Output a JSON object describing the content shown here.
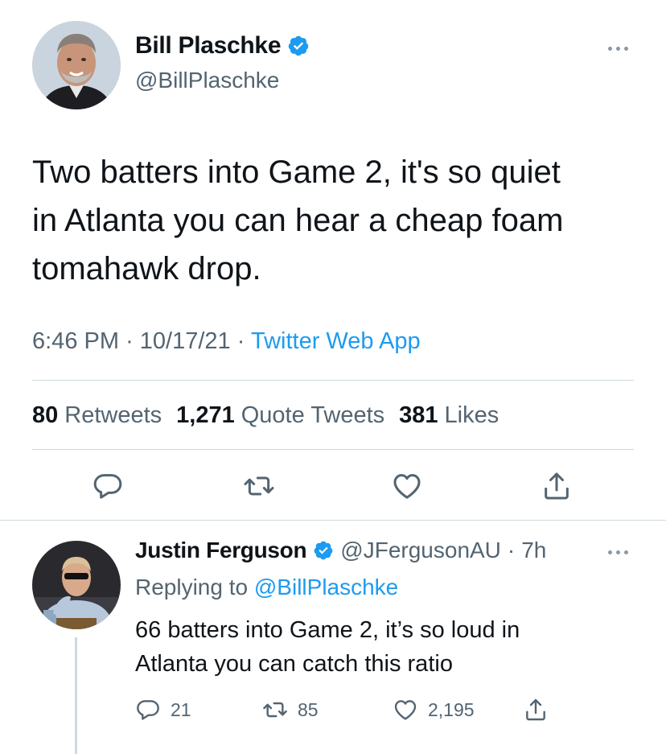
{
  "main_tweet": {
    "author_name": "Bill Plaschke",
    "author_handle": "@BillPlaschke",
    "text": "Two batters into Game 2, it's so quiet\nin Atlanta you can hear a cheap foam\ntomahawk drop.",
    "time": "6:46 PM",
    "date": "10/17/21",
    "separator": "·",
    "source": "Twitter Web App",
    "retweets_count": "80",
    "retweets_label": "Retweets",
    "quote_count": "1,271",
    "quote_label": "Quote Tweets",
    "likes_count": "381",
    "likes_label": "Likes"
  },
  "reply_tweet": {
    "author_name": "Justin Ferguson",
    "author_handle": "@JFergusonAU",
    "separator": "·",
    "time_ago": "7h",
    "replying_prefix": "Replying to",
    "replying_to": "@BillPlaschke",
    "text": "66 batters into Game 2, it’s so loud in\nAtlanta you can catch this ratio",
    "reply_count": "21",
    "retweet_count": "85",
    "like_count": "2,195"
  },
  "icons": {
    "verified": "verified-badge-icon",
    "more": "more-dots-icon",
    "reply": "reply-icon",
    "retweet": "retweet-icon",
    "like": "heart-icon",
    "share": "share-icon"
  },
  "colors": {
    "accent": "#1d9bf0",
    "text": "#0f1419",
    "muted": "#536471",
    "divider": "#cfd9de"
  }
}
